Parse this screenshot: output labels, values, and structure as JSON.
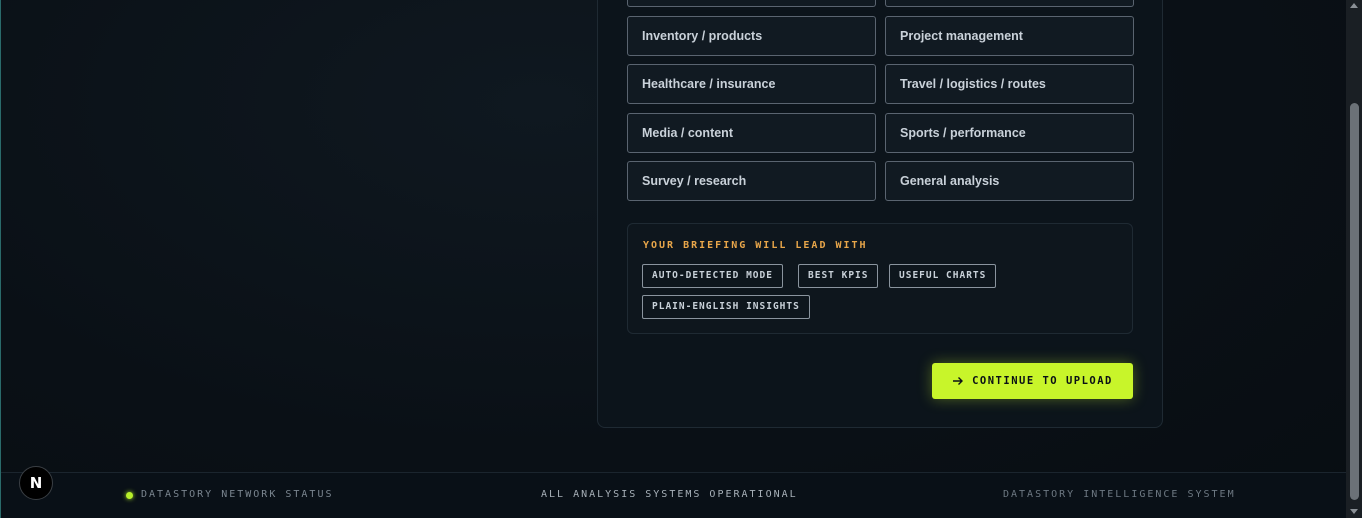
{
  "options": {
    "row0": [
      "",
      ""
    ],
    "items": [
      "Inventory / products",
      "Project management",
      "Healthcare / insurance",
      "Travel / logistics / routes",
      "Media / content",
      "Sports / performance",
      "Survey / research",
      "General analysis"
    ]
  },
  "briefing": {
    "title": "YOUR BRIEFING WILL LEAD WITH",
    "chips": [
      "AUTO-DETECTED MODE",
      "BEST KPIS",
      "USEFUL CHARTS",
      "PLAIN-ENGLISH INSIGHTS"
    ]
  },
  "cta": {
    "label": "CONTINUE TO UPLOAD",
    "icon": "arrow-right-icon",
    "color": "#c8f52a"
  },
  "footer": {
    "left": "DATASTORY NETWORK STATUS",
    "middle": "ALL ANALYSIS SYSTEMS OPERATIONAL",
    "right": "DATASTORY INTELLIGENCE SYSTEM",
    "status_color": "#b8f02a"
  },
  "badge": {
    "letter": "N"
  }
}
